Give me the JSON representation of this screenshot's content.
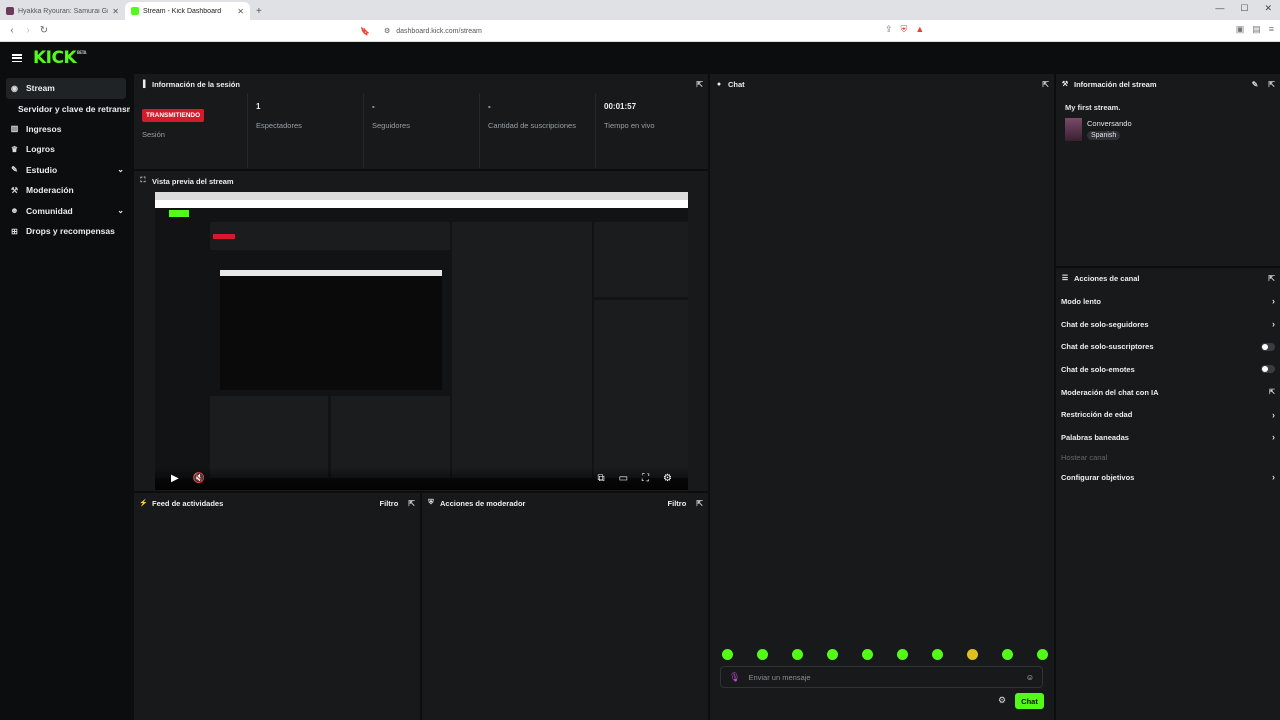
{
  "browser": {
    "tabs": [
      {
        "title": "Hyakka Ryouran: Samurai Girls Co",
        "active": false
      },
      {
        "title": "Stream - Kick Dashboard",
        "active": true
      }
    ],
    "new_tab": "+",
    "url": "dashboard.kick.com/stream"
  },
  "app": {
    "logo": "KICK",
    "logo_tag": "BETA"
  },
  "sidebar": {
    "items": [
      {
        "label": "Stream",
        "icon": "broadcast-icon",
        "glyph": "((·))"
      },
      {
        "label": "Servidor y clave de retransmisión"
      },
      {
        "label": "Ingresos",
        "icon": "chart-icon",
        "glyph": "▥"
      },
      {
        "label": "Logros",
        "icon": "trophy-icon",
        "glyph": "🏆"
      },
      {
        "label": "Estudio",
        "icon": "palette-icon",
        "glyph": "✎"
      },
      {
        "label": "Moderación",
        "icon": "wrench-icon",
        "glyph": "⚒"
      },
      {
        "label": "Comunidad",
        "icon": "people-icon",
        "glyph": "👥"
      },
      {
        "label": "Drops y recompensas",
        "icon": "gift-icon",
        "glyph": "🎁"
      }
    ]
  },
  "session": {
    "title": "Información de la sesión",
    "live_badge": "TRANSMITIENDO",
    "session_label": "Sesión",
    "stats": [
      {
        "value": "1",
        "label": "Espectadores"
      },
      {
        "value": "-",
        "label": "Seguidores"
      },
      {
        "value": "-",
        "label": "Cantidad de suscripciones"
      },
      {
        "value": "00:01:57",
        "label": "Tiempo en vivo"
      }
    ]
  },
  "preview": {
    "title": "Vista previa del stream"
  },
  "chat": {
    "title": "Chat",
    "placeholder": "Enviar un mensaje",
    "send_label": "Chat"
  },
  "stream_info": {
    "title": "Información del stream",
    "stream_title": "My first stream.",
    "category": "Conversando",
    "language": "Spanish"
  },
  "channel_actions": {
    "title": "Acciones de canal",
    "items": [
      {
        "label": "Modo lento",
        "control": "chevron"
      },
      {
        "label": "Chat de solo-seguidores",
        "control": "chevron"
      },
      {
        "label": "Chat de solo-suscriptores",
        "control": "toggle"
      },
      {
        "label": "Chat de solo-emotes",
        "control": "toggle"
      },
      {
        "label": "Moderación del chat con IA",
        "control": "external"
      },
      {
        "label": "Restricción de edad",
        "control": "chevron"
      },
      {
        "label": "Palabras baneadas",
        "control": "chevron"
      },
      {
        "label": "Hostear canal",
        "control": "none",
        "disabled": true
      },
      {
        "label": "Configurar objetivos",
        "control": "chevron"
      }
    ]
  },
  "activity_feed": {
    "title": "Feed de actividades",
    "filter": "Filtro"
  },
  "mod_actions": {
    "title": "Acciones de moderador",
    "filter": "Filtro"
  },
  "colors": {
    "brand": "#53fc18",
    "live": "#d31b2c",
    "panel": "#17191b",
    "background": "#0b0d0e"
  }
}
